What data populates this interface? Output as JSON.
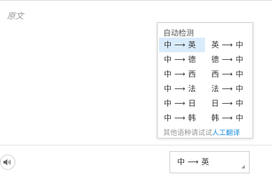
{
  "source": {
    "placeholder": "原文"
  },
  "popup": {
    "auto_detect": "自动检测",
    "arrow": "⟶",
    "pairs": [
      {
        "left": {
          "from": "中",
          "to": "英",
          "selected": true
        },
        "right": {
          "from": "英",
          "to": "中"
        }
      },
      {
        "left": {
          "from": "中",
          "to": "德"
        },
        "right": {
          "from": "德",
          "to": "中"
        }
      },
      {
        "left": {
          "from": "中",
          "to": "西"
        },
        "right": {
          "from": "西",
          "to": "中"
        }
      },
      {
        "left": {
          "from": "中",
          "to": "法"
        },
        "right": {
          "from": "法",
          "to": "中"
        }
      },
      {
        "left": {
          "from": "中",
          "to": "日"
        },
        "right": {
          "from": "日",
          "to": "中"
        }
      },
      {
        "left": {
          "from": "中",
          "to": "韩"
        },
        "right": {
          "from": "韩",
          "to": "中"
        }
      }
    ],
    "footer_text": "其他语种请试试",
    "footer_link": "人工翻译"
  },
  "bottom": {
    "selected_from": "中",
    "selected_to": "英",
    "speaker_icon": "speaker-icon"
  }
}
